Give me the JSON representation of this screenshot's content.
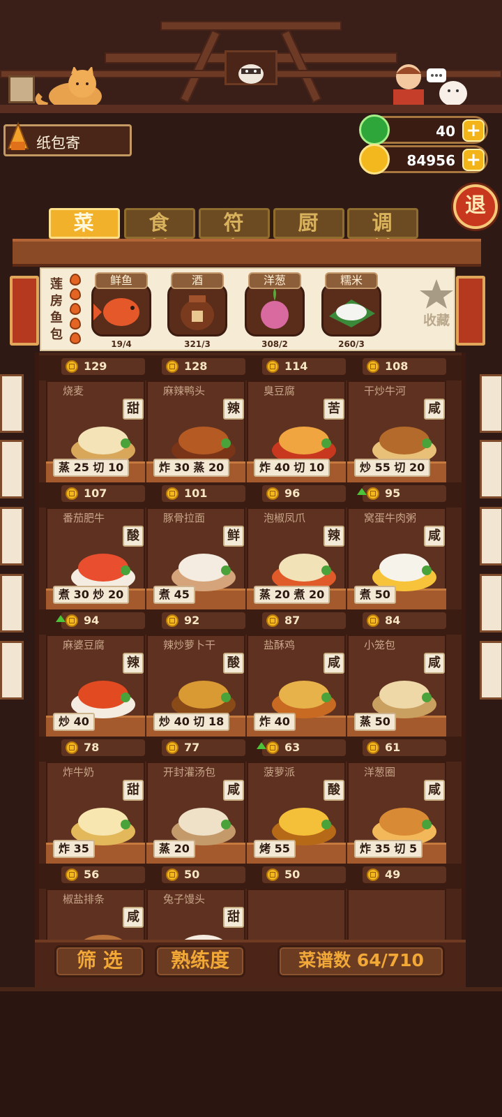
{
  "dish_name": "纸包寄",
  "currency": {
    "gems": "40",
    "coins": "84956",
    "plus": "+"
  },
  "exit_label": "退",
  "tabs": [
    "菜谱",
    "食材",
    "符文",
    "厨具",
    "调料"
  ],
  "selected_dish": {
    "name_vertical": "莲房鱼包",
    "flame_rating": 5,
    "ingredients": [
      {
        "name": "鲜鱼",
        "count": "19/4"
      },
      {
        "name": "酒",
        "count": "321/3"
      },
      {
        "name": "洋葱",
        "count": "308/2"
      },
      {
        "name": "糯米",
        "count": "260/3"
      }
    ],
    "favorite_label": "收藏"
  },
  "recipes": [
    {
      "price": "129",
      "name": "烧麦",
      "taste": "甜",
      "skills": "蒸 25  切 10",
      "up": false
    },
    {
      "price": "128",
      "name": "麻辣鸭头",
      "taste": "辣",
      "skills": "炸 30  蒸 20",
      "up": false
    },
    {
      "price": "114",
      "name": "臭豆腐",
      "taste": "苦",
      "skills": "炸 40  切 10",
      "up": false
    },
    {
      "price": "108",
      "name": "干炒牛河",
      "taste": "咸",
      "skills": "炒 55  切 20",
      "up": false
    },
    {
      "price": "107",
      "name": "番茄肥牛",
      "taste": "酸",
      "skills": "煮 30  炒 20",
      "up": false
    },
    {
      "price": "101",
      "name": "豚骨拉面",
      "taste": "鲜",
      "skills": "煮 45",
      "up": false
    },
    {
      "price": "96",
      "name": "泡椒凤爪",
      "taste": "辣",
      "skills": "蒸 20  煮 20",
      "up": false
    },
    {
      "price": "95",
      "name": "窝蛋牛肉粥",
      "taste": "咸",
      "skills": "煮 50",
      "up": true
    },
    {
      "price": "94",
      "name": "麻婆豆腐",
      "taste": "辣",
      "skills": "炒 40",
      "up": true
    },
    {
      "price": "92",
      "name": "辣炒萝卜干",
      "taste": "酸",
      "skills": "炒 40  切 18",
      "up": false
    },
    {
      "price": "87",
      "name": "盐酥鸡",
      "taste": "咸",
      "skills": "炸 40",
      "up": false
    },
    {
      "price": "84",
      "name": "小笼包",
      "taste": "咸",
      "skills": "蒸 50",
      "up": false
    },
    {
      "price": "78",
      "name": "炸牛奶",
      "taste": "甜",
      "skills": "炸 35",
      "up": false
    },
    {
      "price": "77",
      "name": "开封灌汤包",
      "taste": "咸",
      "skills": "蒸 20",
      "up": false
    },
    {
      "price": "63",
      "name": "菠萝派",
      "taste": "酸",
      "skills": "烤 55",
      "up": true
    },
    {
      "price": "61",
      "name": "洋葱圈",
      "taste": "咸",
      "skills": "炸 35  切 5",
      "up": false
    },
    {
      "price": "56",
      "name": "椒盐排条",
      "taste": "咸",
      "skills": "",
      "up": false
    },
    {
      "price": "50",
      "name": "兔子馒头",
      "taste": "甜",
      "skills": "",
      "up": false
    },
    {
      "price": "50",
      "name": "",
      "taste": "",
      "skills": "",
      "up": false
    },
    {
      "price": "49",
      "name": "",
      "taste": "",
      "skills": "",
      "up": false
    }
  ],
  "bottom": {
    "filter": "筛 选",
    "proficiency": "熟练度",
    "recipe_count": "菜谱数 64/710"
  },
  "colors": {
    "accent": "#f2b12a",
    "wood": "#5e3121",
    "coin": "#f3b81d",
    "up_arrow": "#4cc338"
  }
}
